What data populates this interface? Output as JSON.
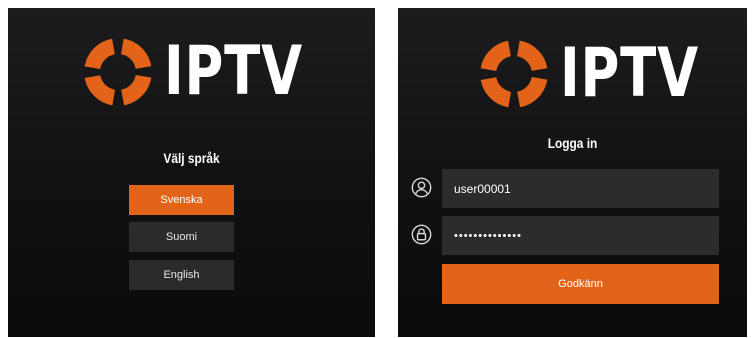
{
  "brand": {
    "name": "IPTV",
    "accent_color": "#e36418"
  },
  "language_screen": {
    "heading": "Välj språk",
    "options": [
      {
        "label": "Svenska",
        "selected": true
      },
      {
        "label": "Suomi",
        "selected": false
      },
      {
        "label": "English",
        "selected": false
      }
    ]
  },
  "login_screen": {
    "heading": "Logga in",
    "username": {
      "value": "user00001",
      "icon": "user-icon"
    },
    "password": {
      "value": "••••••••••••••",
      "icon": "lock-icon"
    },
    "submit_label": "Godkänn"
  }
}
